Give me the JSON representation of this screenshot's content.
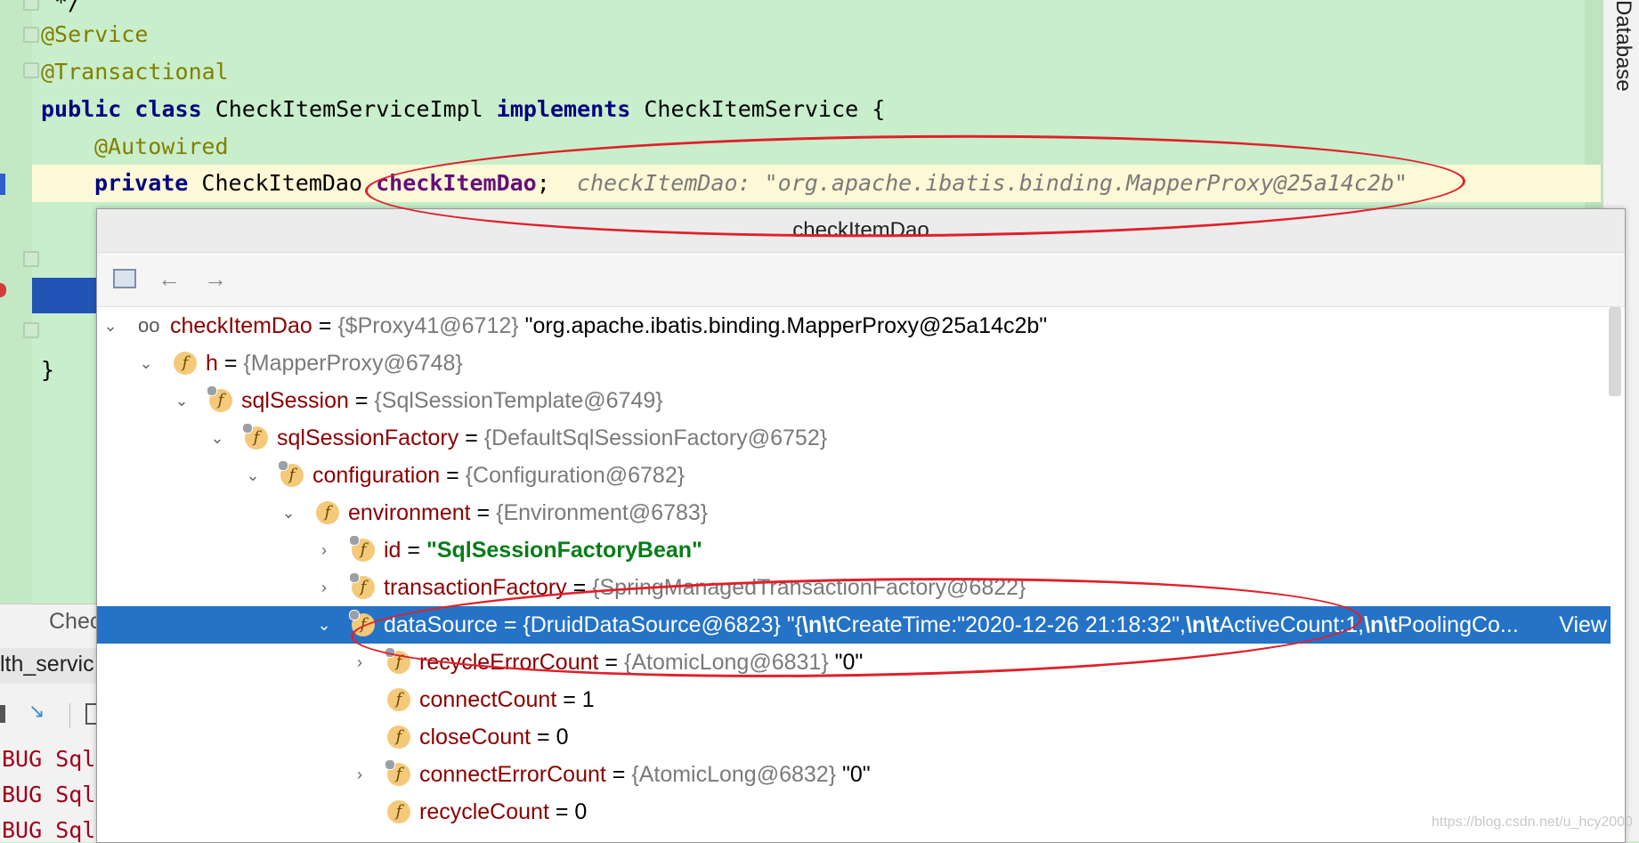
{
  "editor": {
    "lines": [
      {
        "id": "l0",
        "text": " */"
      },
      {
        "id": "l1",
        "annotation": "@Service"
      },
      {
        "id": "l2",
        "annotation": "@Transactional"
      },
      {
        "id": "l3",
        "kw1": "public",
        "kw2": "class",
        "cls": "CheckItemServiceImpl",
        "kw3": "implements",
        "iface": "CheckItemService",
        "brace": "{"
      },
      {
        "id": "l4",
        "annotation": "@Autowired"
      },
      {
        "id": "l5",
        "kw": "private",
        "type": "CheckItemDao",
        "field": "checkItemDao",
        "semi": ";",
        "inlay": "checkItemDao: \"org.apache.ibatis.binding.MapperProxy@25a14c2b\""
      },
      {
        "id": "l6",
        "text": "}"
      }
    ]
  },
  "right_stripe": {
    "label": "Database"
  },
  "left_panel": {
    "tab1": "Chec",
    "tab2": "lth_servic",
    "log_lines": [
      "BUG Sql",
      "BUG Sql",
      "BUG Sql"
    ]
  },
  "popup": {
    "title": "checkItemDao",
    "toolbar": {
      "back": "←",
      "forward": "→"
    },
    "rows": [
      {
        "name": "checkItemDao",
        "eq": "=",
        "type": "{$Proxy41@6712}",
        "value": "\"org.apache.ibatis.binding.MapperProxy@25a14c2b\""
      },
      {
        "name": "h",
        "eq": "=",
        "type": "{MapperProxy@6748}"
      },
      {
        "name": "sqlSession",
        "eq": "=",
        "type": "{SqlSessionTemplate@6749}"
      },
      {
        "name": "sqlSessionFactory",
        "eq": "=",
        "type": "{DefaultSqlSessionFactory@6752}"
      },
      {
        "name": "configuration",
        "eq": "=",
        "type": "{Configuration@6782}"
      },
      {
        "name": "environment",
        "eq": "=",
        "type": "{Environment@6783}"
      },
      {
        "name": "id",
        "eq": "=",
        "value": "\"SqlSessionFactoryBean\""
      },
      {
        "name": "transactionFactory",
        "eq": "=",
        "type": "{SpringManagedTransactionFactory@6822}"
      },
      {
        "name": "dataSource",
        "eq": "=",
        "type": "{DruidDataSource@6823}",
        "v1": "\"{",
        "v2": "\\n\\t",
        "v3": "CreateTime:\"2020-12-26 21:18:32\",",
        "v4": "\\n\\t",
        "v5": "ActiveCount:1,",
        "v6": "\\n\\t",
        "v7": "PoolingCo...",
        "view": "View"
      },
      {
        "name": "recycleErrorCount",
        "eq": "=",
        "type": "{AtomicLong@6831}",
        "value": "\"0\""
      },
      {
        "name": "connectCount",
        "eq": "=",
        "value": "1"
      },
      {
        "name": "closeCount",
        "eq": "=",
        "value": "0"
      },
      {
        "name": "connectErrorCount",
        "eq": "=",
        "type": "{AtomicLong@6832}",
        "value": "\"0\""
      },
      {
        "name": "recycleCount",
        "eq": "=",
        "value": "0"
      }
    ]
  },
  "watermark": "https://blog.csdn.net/u_hcy2000"
}
